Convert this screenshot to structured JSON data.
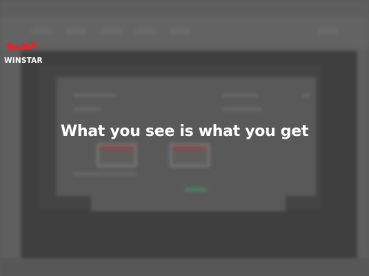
{
  "brand": {
    "name": "WINSTAR",
    "mark_color": "#e0282c"
  },
  "overlay": {
    "headline": "What you see is what you get"
  },
  "colors": {
    "background": "#5b5b5b",
    "text": "#ffffff",
    "dialog_accent": "#8a4a4a",
    "confirm_accent": "#4f7a5c"
  }
}
